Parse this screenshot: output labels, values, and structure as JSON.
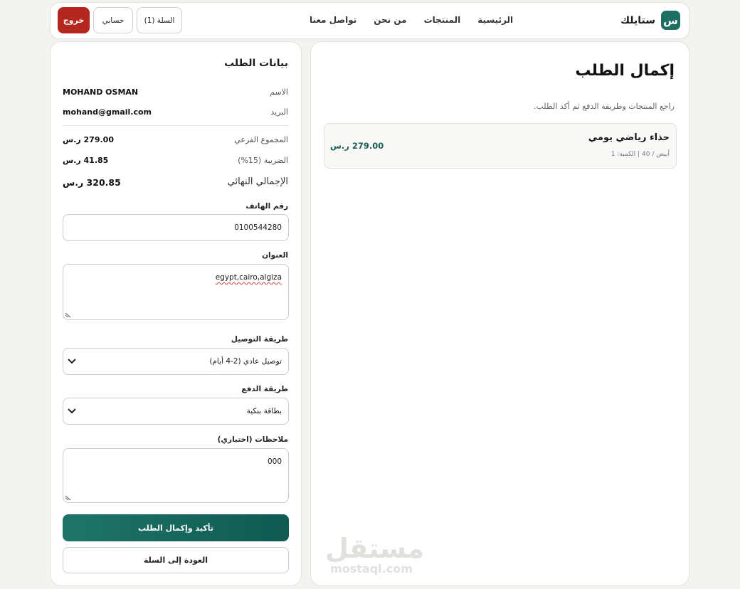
{
  "nav": {
    "brand_letter": "س",
    "brand_name": "ستايلك",
    "links": [
      "الرئيسية",
      "المنتجات",
      "من نحن",
      "تواصل معنا"
    ],
    "cart_label": "السلة (1)",
    "account_label": "حسابي",
    "logout_label": "خروج"
  },
  "main": {
    "title": "إكمال الطلب",
    "subtitle": "راجع المنتجات وطريقة الدفع ثم أكد الطلب.",
    "product": {
      "name": "حذاء رياضي يومي",
      "meta": "أبيض / 40 | الكمية: 1",
      "price": "279.00 ر.س"
    },
    "watermark_ar": "مستقل",
    "watermark_en": "mostaql.com"
  },
  "order": {
    "title": "بيانات الطلب",
    "name_label": "الاسم",
    "name_value": "MOHAND OSMAN",
    "email_label": "البريد",
    "email_value": "mohand@gmail.com",
    "subtotal_label": "المجموع الفرعي",
    "subtotal_value": "279.00 ر.س",
    "tax_label": "الضريبة (15%)",
    "tax_value": "41.85 ر.س",
    "total_label": "الإجمالي النهائي",
    "total_value": "320.85 ر.س",
    "phone_label": "رقم الهاتف",
    "phone_value": "0100544280",
    "address_label": "العنوان",
    "address_value": "egypt,cairo,algiza",
    "delivery_label": "طريقة التوصيل",
    "delivery_value": "توصيل عادي (2-4 أيام)",
    "payment_label": "طريقة الدفع",
    "payment_value": "بطاقة بنكية",
    "notes_label": "ملاحظات (اختياري)",
    "notes_value": "000",
    "confirm_label": "تأكيد وإكمال الطلب",
    "back_label": "العودة إلى السلة"
  },
  "colors": {
    "primary": "#1f6e63",
    "logout": "#b5261e",
    "price": "#1f5e58"
  }
}
